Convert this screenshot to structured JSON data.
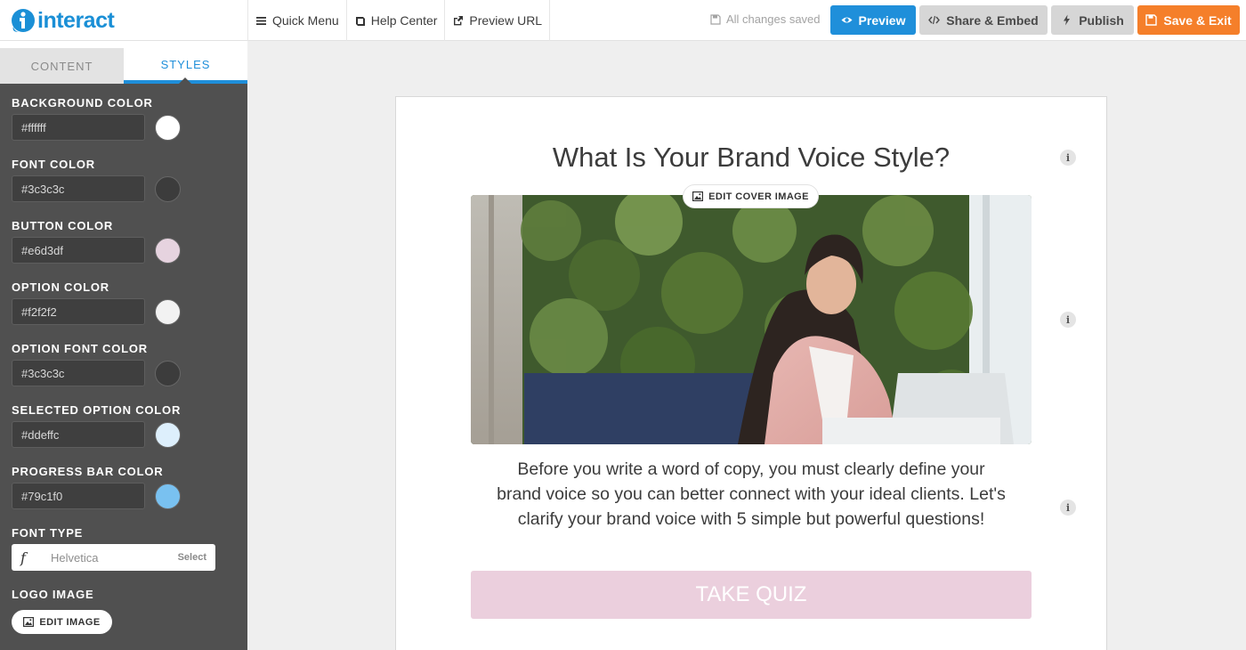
{
  "brand": {
    "logo_text": "interact",
    "accent": "#1f8fda"
  },
  "topnav": [
    {
      "label": "Quick Menu",
      "icon": "hamburger-icon"
    },
    {
      "label": "Help Center",
      "icon": "book-icon"
    },
    {
      "label": "Preview URL",
      "icon": "external-link-icon"
    }
  ],
  "status": {
    "saved_text": "All changes saved"
  },
  "actions": {
    "preview": "Preview",
    "share": "Share & Embed",
    "publish": "Publish",
    "save_exit": "Save & Exit",
    "colors": {
      "preview": "#1f8fda",
      "save_exit": "#f57f2a",
      "neutral": "#d6d6d6"
    }
  },
  "tabs": {
    "content": "CONTENT",
    "styles": "STYLES",
    "active": "STYLES"
  },
  "styles": [
    {
      "label": "BACKGROUND COLOR",
      "value": "#ffffff"
    },
    {
      "label": "FONT COLOR",
      "value": "#3c3c3c"
    },
    {
      "label": "BUTTON COLOR",
      "value": "#e6d3df"
    },
    {
      "label": "OPTION COLOR",
      "value": "#f2f2f2"
    },
    {
      "label": "OPTION FONT COLOR",
      "value": "#3c3c3c"
    },
    {
      "label": "SELECTED OPTION COLOR",
      "value": "#ddeffc"
    },
    {
      "label": "PROGRESS BAR COLOR",
      "value": "#79c1f0"
    }
  ],
  "font_type": {
    "label": "FONT TYPE",
    "icon_glyph": "f",
    "value": "Helvetica",
    "select_label": "Select"
  },
  "logo_image": {
    "label": "LOGO IMAGE",
    "button": "EDIT IMAGE"
  },
  "quiz": {
    "title": "What Is Your Brand Voice Style?",
    "edit_cover": "EDIT COVER IMAGE",
    "description": "Before you write a word of copy, you must clearly define your brand voice so you can better connect with your ideal clients. Let's clarify your brand voice with 5 simple but powerful questions!",
    "button": "TAKE QUIZ",
    "button_color": "#ebcfdd"
  },
  "info_glyph": "i"
}
